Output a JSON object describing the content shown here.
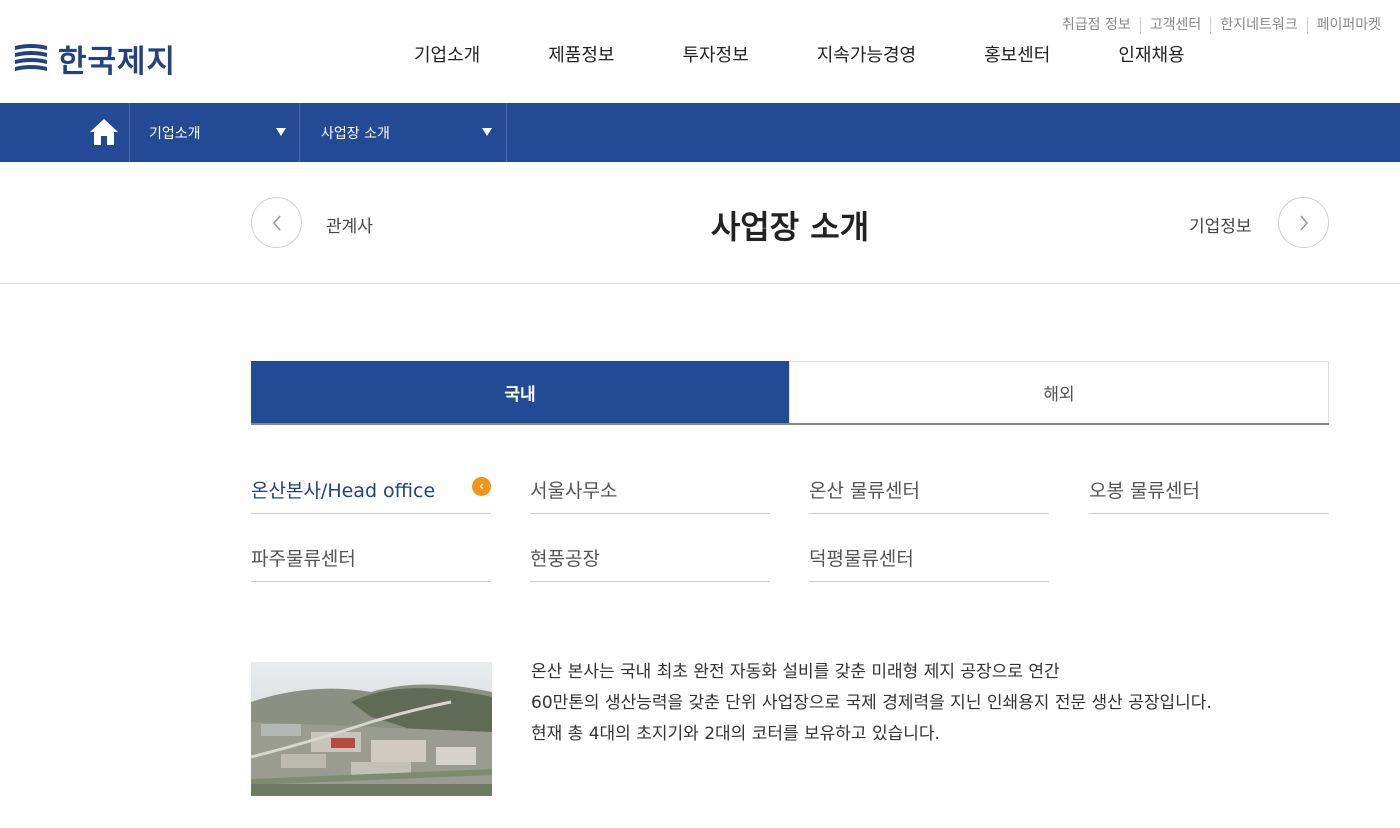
{
  "header": {
    "logo_text": "한국제지",
    "util_links": [
      "취급점 정보",
      "고객센터",
      "한지네트워크",
      "페이퍼마켓"
    ],
    "gnb": [
      "기업소개",
      "제품정보",
      "투자정보",
      "지속가능경영",
      "홍보센터",
      "인재채용"
    ]
  },
  "location": {
    "depth1": "기업소개",
    "depth2": "사업장 소개"
  },
  "titlebar": {
    "prev_label": "관계사",
    "title": "사업장 소개",
    "next_label": "기업정보"
  },
  "tabs": [
    {
      "label": "국내",
      "active": true
    },
    {
      "label": "해외",
      "active": false
    }
  ],
  "sites": [
    {
      "label": "온산본사/Head office",
      "active": true
    },
    {
      "label": "서울사무소",
      "active": false
    },
    {
      "label": "온산 물류센터",
      "active": false
    },
    {
      "label": "오봉 물류센터",
      "active": false
    },
    {
      "label": "파주물류센터",
      "active": false
    },
    {
      "label": "현풍공장",
      "active": false
    },
    {
      "label": "덕평물류센터",
      "active": false
    }
  ],
  "description": [
    "온산 본사는 국내 최초 완전 자동화 설비를 갖춘 미래형 제지 공장으로 연간",
    "60만톤의 생산능력을 갖춘 단위 사업장으로 국제 경제력을 지닌 인쇄용지 전문 생산 공장입니다.",
    "현재 총 4대의 초지기와 2대의 코터를 보유하고 있습니다."
  ],
  "colors": {
    "brand_blue": "#234a94",
    "accent_orange": "#f0961b"
  },
  "icons": {
    "home": "home-icon",
    "prev": "chevron-left-icon",
    "next": "chevron-right-icon",
    "active_badge": "chevron-left-icon"
  }
}
